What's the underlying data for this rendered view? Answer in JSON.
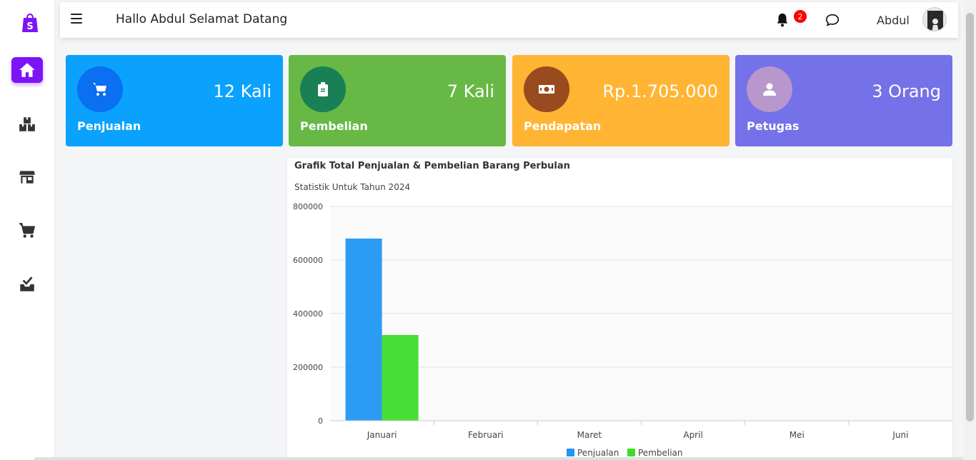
{
  "topbar": {
    "greeting": "Hallo Abdul Selamat Datang",
    "notification_count": "2",
    "username": "Abdul"
  },
  "sidebar": {
    "items": [
      {
        "icon": "home-icon",
        "active": true
      },
      {
        "icon": "boxes-icon",
        "active": false
      },
      {
        "icon": "store-icon",
        "active": false
      },
      {
        "icon": "cart-icon",
        "active": false
      },
      {
        "icon": "inbox-check-icon",
        "active": false
      }
    ]
  },
  "cards": [
    {
      "label": "Penjualan",
      "value": "12 Kali",
      "color": "#0aa2fd",
      "icon": "cart-icon",
      "icon_bg": "#0a6ff0"
    },
    {
      "label": "Pembelian",
      "value": "7 Kali",
      "color": "#68b845",
      "icon": "clipboard-icon",
      "icon_bg": "#188054"
    },
    {
      "label": "Pendapatan",
      "value": "Rp.1.705.000",
      "color": "#ffb533",
      "icon": "money-icon",
      "icon_bg": "#994a1f"
    },
    {
      "label": "Petugas",
      "value": "3 Orang",
      "color": "#7571e8",
      "icon": "user-icon",
      "icon_bg": "#b797cc"
    }
  ],
  "chart": {
    "title": "Grafik Total Penjualan & Pembelian Barang Perbulan",
    "subtitle": "Statistik Untuk Tahun 2024"
  },
  "chart_data": {
    "type": "bar",
    "title": "Grafik Total Penjualan & Pembelian Barang Perbulan",
    "subtitle": "Statistik Untuk Tahun 2024",
    "categories": [
      "Januari",
      "Februari",
      "Maret",
      "April",
      "Mei",
      "Juni"
    ],
    "series": [
      {
        "name": "Penjualan",
        "color": "#2196f3",
        "values": [
          680000,
          0,
          0,
          0,
          0,
          0
        ]
      },
      {
        "name": "Pembelian",
        "color": "#3ddc2b",
        "values": [
          320000,
          0,
          0,
          0,
          0,
          0
        ]
      }
    ],
    "yticks": [
      "0",
      "200000",
      "400000",
      "600000",
      "800000"
    ],
    "ylim": [
      0,
      800000
    ],
    "grid": true,
    "legend": "bottom"
  }
}
